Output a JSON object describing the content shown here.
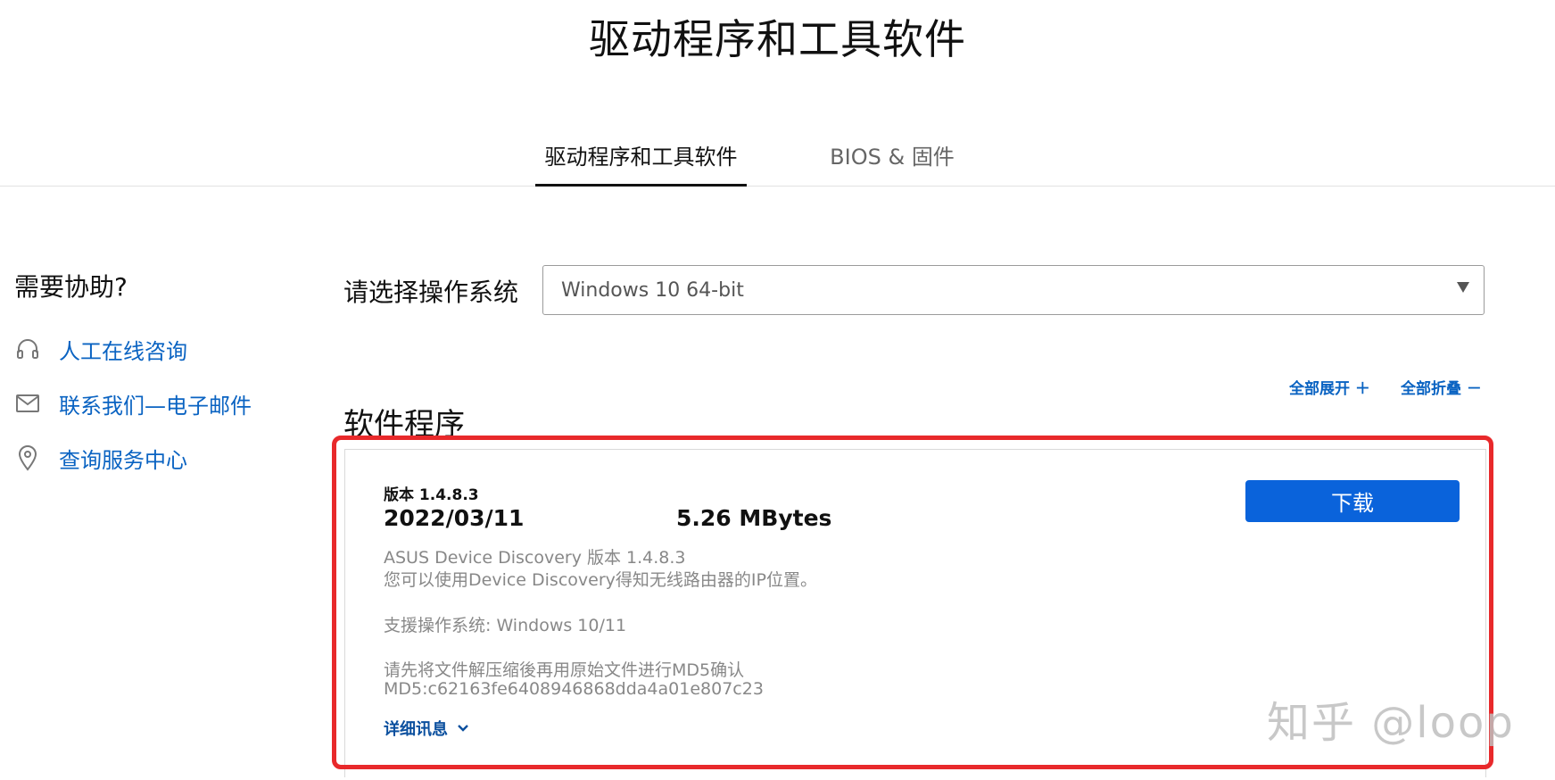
{
  "page": {
    "title": "驱动程序和工具软件"
  },
  "tabs": [
    {
      "label": "驱动程序和工具软件",
      "active": true
    },
    {
      "label": "BIOS & 固件",
      "active": false
    }
  ],
  "help": {
    "title": "需要协助?",
    "items": [
      {
        "icon": "headset-icon",
        "label": "人工在线咨询"
      },
      {
        "icon": "mail-icon",
        "label": "联系我们—电子邮件"
      },
      {
        "icon": "location-pin-icon",
        "label": "查询服务中心"
      }
    ]
  },
  "os_selector": {
    "label": "请选择操作系统",
    "selected": "Windows 10 64-bit"
  },
  "controls": {
    "expand_all": "全部展开 ＋",
    "collapse_all": "全部折叠 －"
  },
  "section": {
    "title": "软件程序"
  },
  "card": {
    "version_line": "版本 1.4.8.3",
    "date": "2022/03/11",
    "size": "5.26 MBytes",
    "download_label": "下载",
    "desc_line1": "ASUS Device Discovery 版本 1.4.8.3",
    "desc_line2": "您可以使用Device Discovery得知无线路由器的IP位置。",
    "supported_os": "支援操作系统: Windows 10/11",
    "md5_note": "请先将文件解压缩後再用原始文件进行MD5确认",
    "md5": "MD5:c62163fe6408946868dda4a01e807c23",
    "details_label": "详细讯息"
  },
  "watermark": "知乎 @loop",
  "colors": {
    "accent": "#0a63db",
    "link": "#0a63c2",
    "highlight": "#e8292b"
  }
}
